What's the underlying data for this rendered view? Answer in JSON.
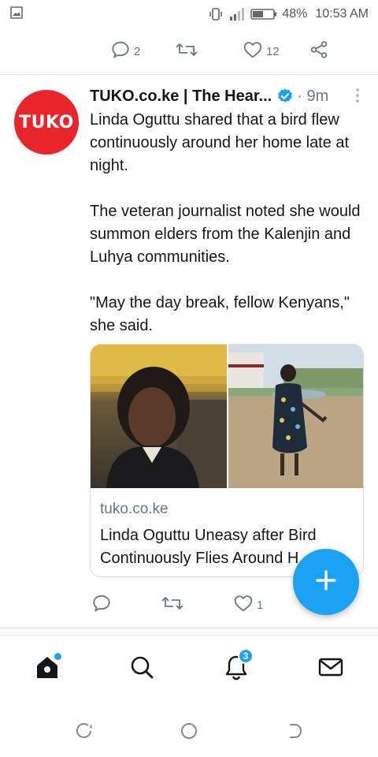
{
  "status_bar": {
    "battery": "48%",
    "time": "10:53 AM"
  },
  "previous_tweet": {
    "reply_count": "2",
    "like_count": "12"
  },
  "tweet": {
    "author_name": "TUKO.co.ke | The Hear...",
    "avatar_text": "TUKO",
    "timestamp": "· 9m",
    "text_paragraphs": [
      "Linda Oguttu shared that a bird flew continuously around her home late at night.",
      "The veteran journalist noted she would summon elders from the Kalenjin and Luhya communities.",
      "\"May the day break, fellow Kenyans,\" she said."
    ],
    "card": {
      "domain": "tuko.co.ke",
      "title": "Linda Oguttu Uneasy after Bird Continuously Flies Around H..."
    },
    "like_count": "1"
  },
  "bottom_nav": {
    "notifications_badge": "3"
  },
  "colors": {
    "accent": "#1da1f2",
    "brand_red": "#e8252a",
    "muted": "#657786"
  }
}
